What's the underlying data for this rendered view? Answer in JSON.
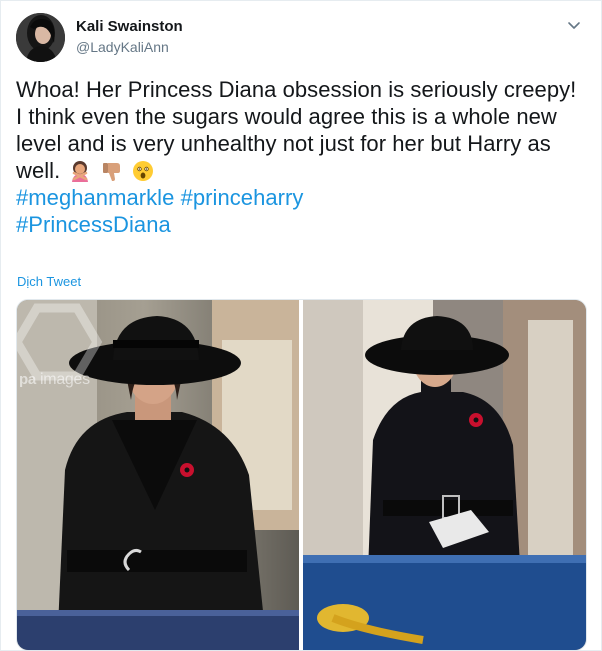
{
  "author": {
    "name": "Kali Swainston",
    "handle": "@LadyKaliAnn"
  },
  "tweet": {
    "lines": [
      "Whoa! Her Princess Diana obsession is seriously creepy!",
      "I think even the sugars would agree this is a whole new",
      "level and is very unhealthy not just for her but Harry as",
      "well."
    ],
    "emojis": [
      "woman-gesturing-no-icon",
      "thumbs-down-icon",
      "astonished-face-icon"
    ],
    "hashtags": [
      "#meghanmarkle",
      "#princeharry",
      "#PrincessDiana"
    ]
  },
  "translate_label": "Dịch Tweet",
  "media": {
    "watermark_bold": "pa",
    "watermark_light": " images"
  },
  "colors": {
    "link": "#1b95e0",
    "text": "#14171a",
    "secondary": "#657786",
    "border": "#e6ecf0"
  }
}
